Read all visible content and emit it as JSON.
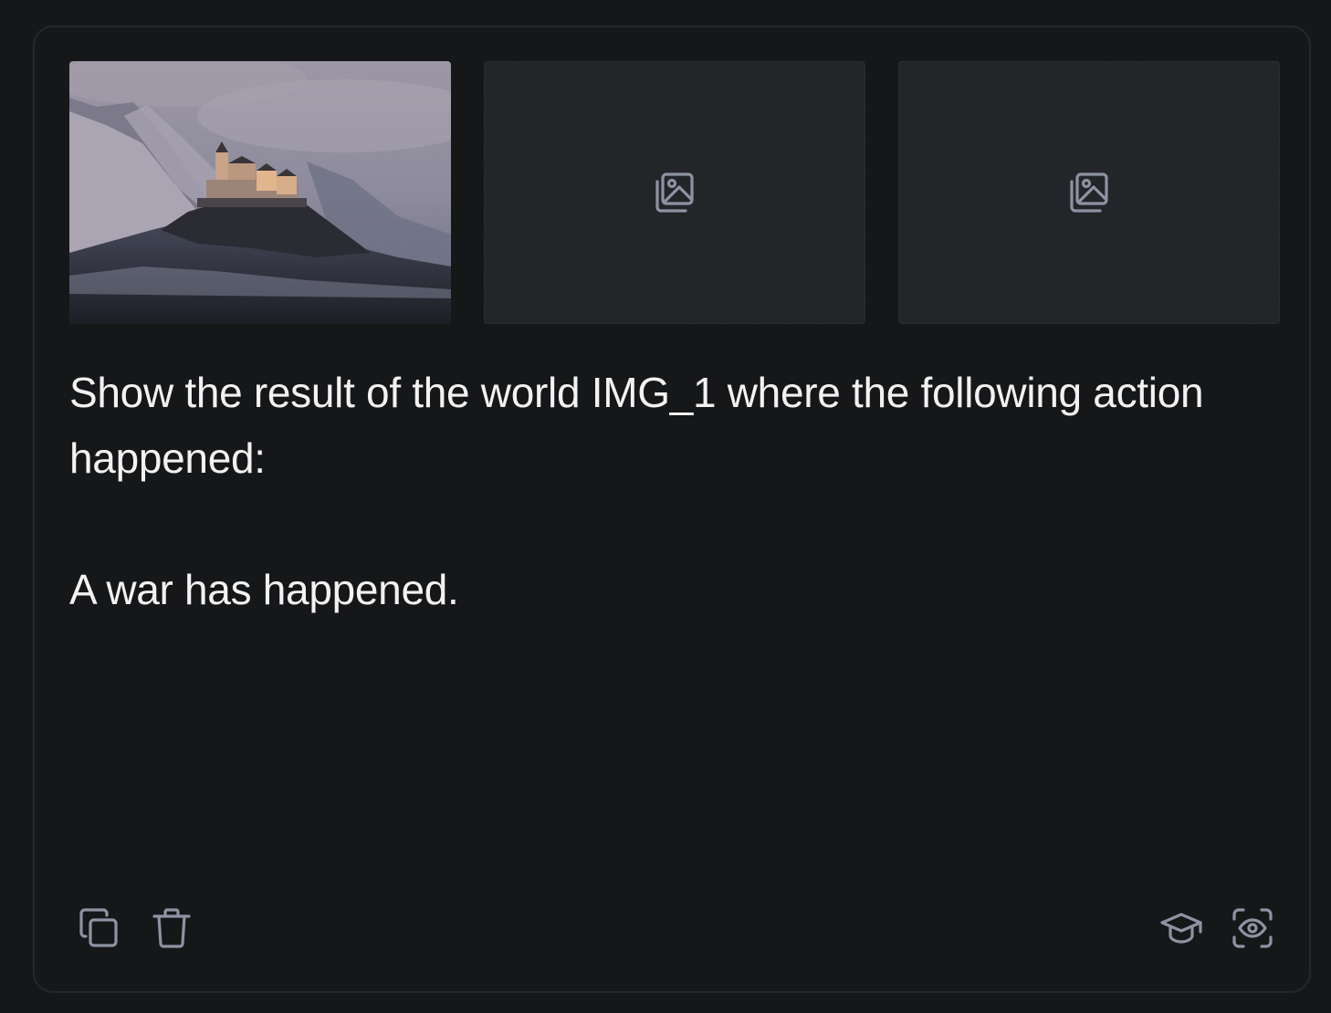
{
  "thumbnails": [
    {
      "state": "image",
      "icon": "castle-landscape-image"
    },
    {
      "state": "empty",
      "icon": "image-placeholder-icon"
    },
    {
      "state": "empty",
      "icon": "image-placeholder-icon"
    }
  ],
  "prompt": {
    "line1": "Show the result of the world IMG_1  where the following action happened:",
    "line2": "A war has happened."
  },
  "actions": {
    "left": [
      {
        "icon": "copy-icon"
      },
      {
        "icon": "trash-icon"
      }
    ],
    "right": [
      {
        "icon": "graduation-cap-icon"
      },
      {
        "icon": "eye-scan-icon"
      }
    ]
  },
  "colors": {
    "background": "#161719",
    "card_border": "#26272b",
    "placeholder_bg": "#242528",
    "icon": "#8e93a3",
    "text": "#f2f2f3"
  }
}
